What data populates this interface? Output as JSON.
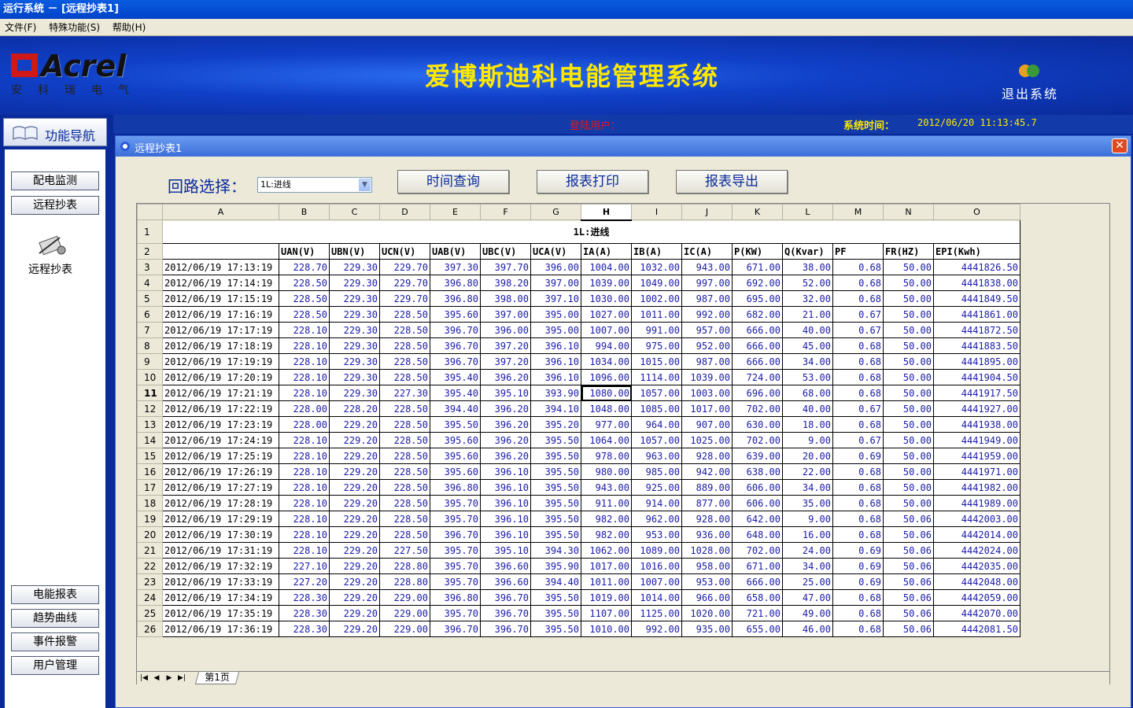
{
  "window": {
    "title": "运行系统 － [远程抄表1]"
  },
  "menu": [
    "文件(F)",
    "特殊功能(S)",
    "帮助(H)"
  ],
  "header": {
    "logo_text": "Acrel",
    "logo_sub": "安科瑞电气",
    "system_title": "爱博斯迪科电能管理系统",
    "exit_label": "退出系统"
  },
  "info": {
    "login_label": "登陆用户：",
    "time_label": "系统时间：",
    "time_value": "2012/06/20   11:13:45.7"
  },
  "nav": {
    "header": "功能导航",
    "top_buttons": [
      "配电监测",
      "远程抄表"
    ],
    "icon_label": "远程抄表",
    "bottom_buttons": [
      "电能报表",
      "趋势曲线",
      "事件报警",
      "用户管理"
    ]
  },
  "panel": {
    "title": "远程抄表1",
    "circuit_label": "回路选择：",
    "circuit_value": "1L:进线",
    "btn_query": "时间查询",
    "btn_print": "报表打印",
    "btn_export": "报表导出",
    "sheet_tab": "第1页"
  },
  "sheet": {
    "col_letters": [
      "A",
      "B",
      "C",
      "D",
      "E",
      "F",
      "G",
      "H",
      "I",
      "J",
      "K",
      "L",
      "M",
      "N",
      "O"
    ],
    "active_col": "H",
    "active_row": 11,
    "title": "1L:进线",
    "headers": [
      "",
      "UAN(V)",
      "UBN(V)",
      "UCN(V)",
      "UAB(V)",
      "UBC(V)",
      "UCA(V)",
      "IA(A)",
      "IB(A)",
      "IC(A)",
      "P(KW)",
      "Q(Kvar)",
      "PF",
      "FR(HZ)",
      "EPI(Kwh)"
    ],
    "rows": [
      [
        "2012/06/19 17:13:19",
        "228.70",
        "229.30",
        "229.70",
        "397.30",
        "397.70",
        "396.00",
        "1004.00",
        "1032.00",
        "943.00",
        "671.00",
        "38.00",
        "0.68",
        "50.00",
        "4441826.50"
      ],
      [
        "2012/06/19 17:14:19",
        "228.50",
        "229.30",
        "229.70",
        "396.80",
        "398.20",
        "397.00",
        "1039.00",
        "1049.00",
        "997.00",
        "692.00",
        "52.00",
        "0.68",
        "50.00",
        "4441838.00"
      ],
      [
        "2012/06/19 17:15:19",
        "228.50",
        "229.30",
        "229.70",
        "396.80",
        "398.00",
        "397.10",
        "1030.00",
        "1002.00",
        "987.00",
        "695.00",
        "32.00",
        "0.68",
        "50.00",
        "4441849.50"
      ],
      [
        "2012/06/19 17:16:19",
        "228.50",
        "229.30",
        "228.50",
        "395.60",
        "397.00",
        "395.00",
        "1027.00",
        "1011.00",
        "992.00",
        "682.00",
        "21.00",
        "0.67",
        "50.00",
        "4441861.00"
      ],
      [
        "2012/06/19 17:17:19",
        "228.10",
        "229.30",
        "228.50",
        "396.70",
        "396.00",
        "395.00",
        "1007.00",
        "991.00",
        "957.00",
        "666.00",
        "40.00",
        "0.67",
        "50.00",
        "4441872.50"
      ],
      [
        "2012/06/19 17:18:19",
        "228.10",
        "229.30",
        "228.50",
        "396.70",
        "397.20",
        "396.10",
        "994.00",
        "975.00",
        "952.00",
        "666.00",
        "45.00",
        "0.68",
        "50.00",
        "4441883.50"
      ],
      [
        "2012/06/19 17:19:19",
        "228.10",
        "229.30",
        "228.50",
        "396.70",
        "397.20",
        "396.10",
        "1034.00",
        "1015.00",
        "987.00",
        "666.00",
        "34.00",
        "0.68",
        "50.00",
        "4441895.00"
      ],
      [
        "2012/06/19 17:20:19",
        "228.10",
        "229.30",
        "228.50",
        "395.40",
        "396.20",
        "396.10",
        "1096.00",
        "1114.00",
        "1039.00",
        "724.00",
        "53.00",
        "0.68",
        "50.00",
        "4441904.50"
      ],
      [
        "2012/06/19 17:21:19",
        "228.10",
        "229.30",
        "227.30",
        "395.40",
        "395.10",
        "393.90",
        "1080.00",
        "1057.00",
        "1003.00",
        "696.00",
        "68.00",
        "0.68",
        "50.00",
        "4441917.50"
      ],
      [
        "2012/06/19 17:22:19",
        "228.00",
        "228.20",
        "228.50",
        "394.40",
        "396.20",
        "394.10",
        "1048.00",
        "1085.00",
        "1017.00",
        "702.00",
        "40.00",
        "0.67",
        "50.00",
        "4441927.00"
      ],
      [
        "2012/06/19 17:23:19",
        "228.00",
        "229.20",
        "228.50",
        "395.50",
        "396.20",
        "395.20",
        "977.00",
        "964.00",
        "907.00",
        "630.00",
        "18.00",
        "0.68",
        "50.00",
        "4441938.00"
      ],
      [
        "2012/06/19 17:24:19",
        "228.10",
        "229.20",
        "228.50",
        "395.60",
        "396.20",
        "395.50",
        "1064.00",
        "1057.00",
        "1025.00",
        "702.00",
        "9.00",
        "0.67",
        "50.00",
        "4441949.00"
      ],
      [
        "2012/06/19 17:25:19",
        "228.10",
        "229.20",
        "228.50",
        "395.60",
        "396.20",
        "395.50",
        "978.00",
        "963.00",
        "928.00",
        "639.00",
        "20.00",
        "0.69",
        "50.00",
        "4441959.00"
      ],
      [
        "2012/06/19 17:26:19",
        "228.10",
        "229.20",
        "228.50",
        "395.60",
        "396.10",
        "395.50",
        "980.00",
        "985.00",
        "942.00",
        "638.00",
        "22.00",
        "0.68",
        "50.00",
        "4441971.00"
      ],
      [
        "2012/06/19 17:27:19",
        "228.10",
        "229.20",
        "228.50",
        "396.80",
        "396.10",
        "395.50",
        "943.00",
        "925.00",
        "889.00",
        "606.00",
        "34.00",
        "0.68",
        "50.00",
        "4441982.00"
      ],
      [
        "2012/06/19 17:28:19",
        "228.10",
        "229.20",
        "228.50",
        "395.70",
        "396.10",
        "395.50",
        "911.00",
        "914.00",
        "877.00",
        "606.00",
        "35.00",
        "0.68",
        "50.00",
        "4441989.00"
      ],
      [
        "2012/06/19 17:29:19",
        "228.10",
        "229.20",
        "228.50",
        "395.70",
        "396.10",
        "395.50",
        "982.00",
        "962.00",
        "928.00",
        "642.00",
        "9.00",
        "0.68",
        "50.06",
        "4442003.00"
      ],
      [
        "2012/06/19 17:30:19",
        "228.10",
        "229.20",
        "228.50",
        "396.70",
        "396.10",
        "395.50",
        "982.00",
        "953.00",
        "936.00",
        "648.00",
        "16.00",
        "0.68",
        "50.06",
        "4442014.00"
      ],
      [
        "2012/06/19 17:31:19",
        "228.10",
        "229.20",
        "227.50",
        "395.70",
        "395.10",
        "394.30",
        "1062.00",
        "1089.00",
        "1028.00",
        "702.00",
        "24.00",
        "0.69",
        "50.06",
        "4442024.00"
      ],
      [
        "2012/06/19 17:32:19",
        "227.10",
        "229.20",
        "228.80",
        "395.70",
        "396.60",
        "395.90",
        "1017.00",
        "1016.00",
        "958.00",
        "671.00",
        "34.00",
        "0.69",
        "50.06",
        "4442035.00"
      ],
      [
        "2012/06/19 17:33:19",
        "227.20",
        "229.20",
        "228.80",
        "395.70",
        "396.60",
        "394.40",
        "1011.00",
        "1007.00",
        "953.00",
        "666.00",
        "25.00",
        "0.69",
        "50.06",
        "4442048.00"
      ],
      [
        "2012/06/19 17:34:19",
        "228.30",
        "229.20",
        "229.00",
        "396.80",
        "396.70",
        "395.50",
        "1019.00",
        "1014.00",
        "966.00",
        "658.00",
        "47.00",
        "0.68",
        "50.06",
        "4442059.00"
      ],
      [
        "2012/06/19 17:35:19",
        "228.30",
        "229.20",
        "229.00",
        "395.70",
        "396.70",
        "395.50",
        "1107.00",
        "1125.00",
        "1020.00",
        "721.00",
        "49.00",
        "0.68",
        "50.06",
        "4442070.00"
      ],
      [
        "2012/06/19 17:36:19",
        "228.30",
        "229.20",
        "229.00",
        "396.70",
        "396.70",
        "395.50",
        "1010.00",
        "992.00",
        "935.00",
        "655.00",
        "46.00",
        "0.68",
        "50.06",
        "4442081.50"
      ]
    ]
  },
  "colors": {
    "accent_yellow": "#ffe800",
    "nav_blue": "#0a2a9a",
    "data_blue": "#1a1aaa",
    "login_red": "#e01818"
  }
}
